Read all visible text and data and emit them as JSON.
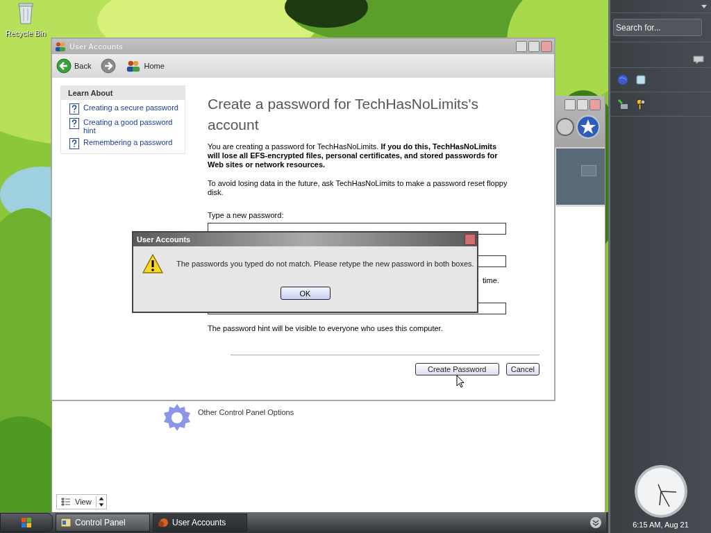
{
  "desktop": {
    "icons": [
      {
        "label": "Recycle Bin"
      }
    ]
  },
  "control_panel": {
    "items": [
      {
        "label": "Other Control Panel Options"
      }
    ],
    "view_button": "View"
  },
  "window": {
    "title": "User Accounts",
    "toolbar": [
      {
        "kind": "back",
        "label": "Back"
      },
      {
        "kind": "forward"
      },
      {
        "kind": "home",
        "label": "Home"
      }
    ],
    "learn_about": {
      "heading": "Learn About",
      "links": [
        {
          "label": "Creating a secure password"
        },
        {
          "label": "Creating a good password hint"
        },
        {
          "label": "Remembering a password"
        }
      ]
    },
    "heading": "Create a password for TechHasNoLimits's account",
    "warning": "You are creating a password for TechHasNoLimits. **If you do this, TechHasNoLimits will lose all EFS-encrypted files, personal certificates, and stored passwords for Web sites or network resources.**",
    "advice": "To avoid losing data in the future, ask TechHasNoLimits to make a password reset floppy disk.",
    "fields": [
      {
        "kind": "password",
        "label": "Type a new password:"
      },
      {
        "kind": "password",
        "note": "time."
      },
      {
        "kind": "hint",
        "note": "The password hint will be visible to everyone who uses this computer."
      }
    ],
    "buttons": [
      {
        "label": "Create Password"
      },
      {
        "label": "Cancel"
      }
    ]
  },
  "dialog": {
    "title": "User Accounts",
    "message": "The passwords you typed do not match. Please retype the new password in both boxes.",
    "button": "OK"
  },
  "sidebar": {
    "search_placeholder": "Search for...",
    "clock": "6:15 AM, Aug 21"
  },
  "taskbar": {
    "tasks": [
      {
        "label": "Control Panel",
        "kind": "folder",
        "selected": false
      },
      {
        "label": "User Accounts",
        "kind": "users",
        "selected": true
      }
    ]
  }
}
